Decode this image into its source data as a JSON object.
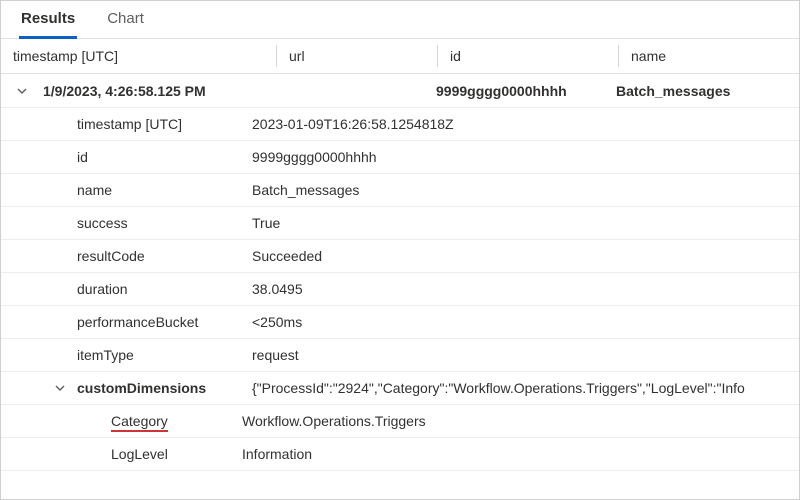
{
  "tabs": {
    "results": "Results",
    "chart": "Chart"
  },
  "columns": {
    "timestamp": "timestamp [UTC]",
    "url": "url",
    "id": "id",
    "name": "name"
  },
  "row": {
    "timestamp_display": "1/9/2023, 4:26:58.125 PM",
    "url": "",
    "id": "9999gggg0000hhhh",
    "name": "Batch_messages"
  },
  "details": {
    "timestamp_label": "timestamp [UTC]",
    "timestamp_value": "2023-01-09T16:26:58.1254818Z",
    "id_label": "id",
    "id_value": "9999gggg0000hhhh",
    "name_label": "name",
    "name_value": "Batch_messages",
    "success_label": "success",
    "success_value": "True",
    "resultCode_label": "resultCode",
    "resultCode_value": "Succeeded",
    "duration_label": "duration",
    "duration_value": "38.0495",
    "performanceBucket_label": "performanceBucket",
    "performanceBucket_value": "<250ms",
    "itemType_label": "itemType",
    "itemType_value": "request",
    "customDimensions_label": "customDimensions",
    "customDimensions_value": "{\"ProcessId\":\"2924\",\"Category\":\"Workflow.Operations.Triggers\",\"LogLevel\":\"Info"
  },
  "customDimensions_children": {
    "category_label": "Category",
    "category_value": "Workflow.Operations.Triggers",
    "loglevel_label": "LogLevel",
    "loglevel_value": "Information"
  }
}
